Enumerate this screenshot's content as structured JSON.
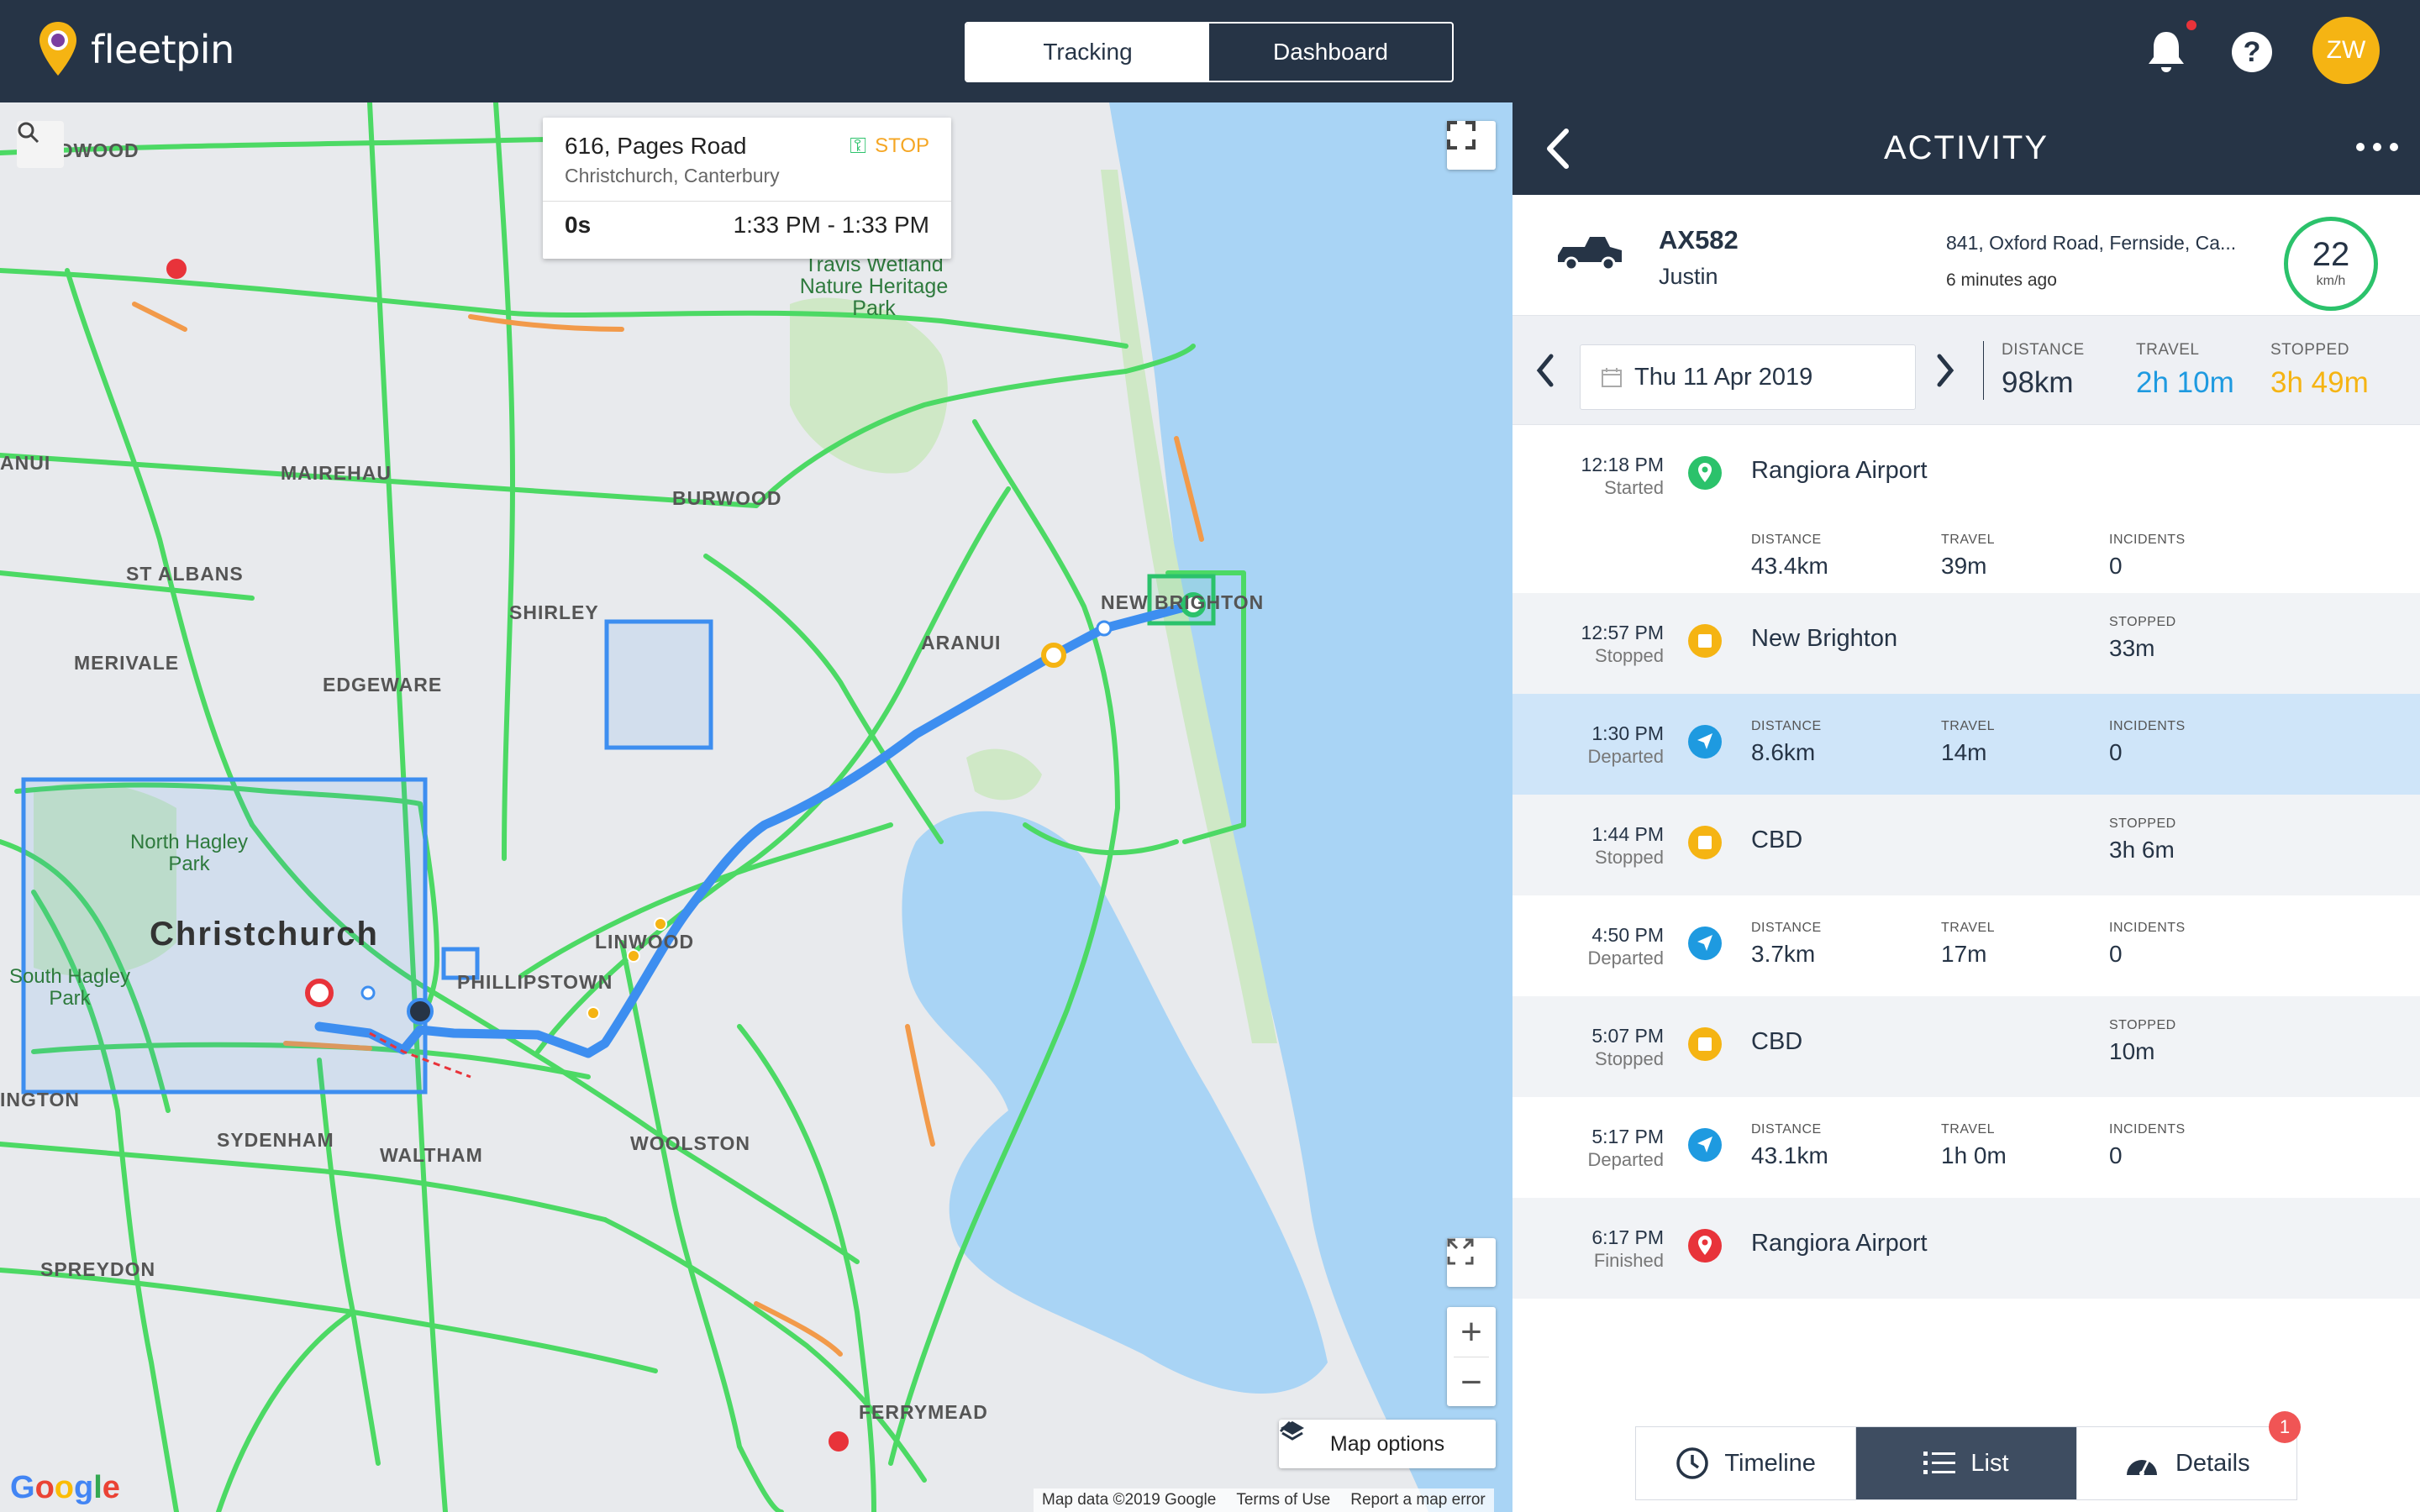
{
  "app": {
    "name": "fleetpin"
  },
  "nav": {
    "tabs": [
      {
        "label": "Tracking",
        "active": true
      },
      {
        "label": "Dashboard",
        "active": false
      }
    ]
  },
  "user": {
    "initials": "ZW"
  },
  "help": {
    "label": "?"
  },
  "map": {
    "popup": {
      "address": "616, Pages Road",
      "city": "Christchurch, Canterbury",
      "status": "STOP",
      "duration": "0s",
      "time_range": "1:33 PM - 1:33 PM"
    },
    "labels": {
      "redwood": "REDWOOD",
      "mairehau": "MAIREHAU",
      "st_albans": "ST ALBANS",
      "burwood": "BURWOOD",
      "shirley": "SHIRLEY",
      "merivale": "MERIVALE",
      "edgeware": "EDGEWARE",
      "aranui": "ARANUI",
      "new_brighton": "NEW BRIGHTON",
      "christchurch": "Christchurch",
      "north_hagley": "North Hagley Park",
      "south_hagley": "South Hagley Park",
      "linwood": "LINWOOD",
      "phillipstown": "PHILLIPSTOWN",
      "woolston": "WOOLSTON",
      "sydenham": "SYDENHAM",
      "waltham": "WALTHAM",
      "spreydon": "SPREYDON",
      "ferrymead": "FERRYMEAD",
      "addington": "INGTON",
      "travis": "Travis Wetland Nature Heritage Park",
      "anui": "ANUI"
    },
    "map_options": "Map options",
    "attribution": [
      "Map data ©2019 Google",
      "Terms of Use",
      "Report a map error"
    ],
    "google": "Google"
  },
  "panel": {
    "title": "ACTIVITY",
    "vehicle": {
      "name": "AX582",
      "driver": "Justin",
      "location": "841, Oxford Road, Fernside, Ca...",
      "updated": "6 minutes ago",
      "speed": "22",
      "speed_unit": "km/h"
    },
    "date": "Thu 11 Apr 2019",
    "summary": {
      "distance_label": "DISTANCE",
      "distance": "98km",
      "travel_label": "TRAVEL",
      "travel": "2h 10m",
      "stopped_label": "STOPPED",
      "stopped": "3h 49m"
    },
    "colors": {
      "travel": "#1e9ae0",
      "stopped": "#f5b413",
      "start": "#2bc26b",
      "finish": "#e8333a",
      "route": "#3d8ef0"
    },
    "events": [
      {
        "time": "12:18 PM",
        "sub": "Started",
        "place": "Rangiora Airport",
        "cols": [
          {
            "l": "DISTANCE",
            "v": "43.4km"
          },
          {
            "l": "TRAVEL",
            "v": "39m"
          },
          {
            "l": "INCIDENTS",
            "v": "0"
          }
        ]
      },
      {
        "time": "12:57 PM",
        "sub": "Stopped",
        "place": "New Brighton",
        "stopped_label": "STOPPED",
        "stopped": "33m"
      },
      {
        "time": "1:30 PM",
        "sub": "Departed",
        "cols": [
          {
            "l": "DISTANCE",
            "v": "8.6km"
          },
          {
            "l": "TRAVEL",
            "v": "14m"
          },
          {
            "l": "INCIDENTS",
            "v": "0"
          }
        ]
      },
      {
        "time": "1:44 PM",
        "sub": "Stopped",
        "place": "CBD",
        "stopped_label": "STOPPED",
        "stopped": "3h 6m"
      },
      {
        "time": "4:50 PM",
        "sub": "Departed",
        "cols": [
          {
            "l": "DISTANCE",
            "v": "3.7km"
          },
          {
            "l": "TRAVEL",
            "v": "17m"
          },
          {
            "l": "INCIDENTS",
            "v": "0"
          }
        ]
      },
      {
        "time": "5:07 PM",
        "sub": "Stopped",
        "place": "CBD",
        "stopped_label": "STOPPED",
        "stopped": "10m"
      },
      {
        "time": "5:17 PM",
        "sub": "Departed",
        "cols": [
          {
            "l": "DISTANCE",
            "v": "43.1km"
          },
          {
            "l": "TRAVEL",
            "v": "1h 0m"
          },
          {
            "l": "INCIDENTS",
            "v": "0"
          }
        ]
      },
      {
        "time": "6:17 PM",
        "sub": "Finished",
        "place": "Rangiora Airport"
      }
    ],
    "bottom_tabs": [
      {
        "label": "Timeline"
      },
      {
        "label": "List",
        "active": true
      },
      {
        "label": "Details"
      }
    ],
    "details_badge": "1"
  }
}
